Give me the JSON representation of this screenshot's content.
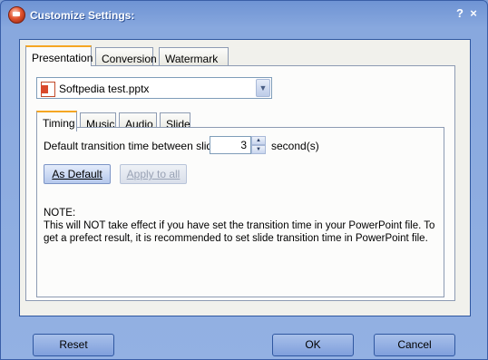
{
  "window": {
    "title": "Customize Settings:",
    "help_glyph": "?",
    "close_glyph": "×"
  },
  "outer_tabs": [
    "Presentation",
    "Conversion",
    "Watermark"
  ],
  "file_select": {
    "value": "Softpedia test.pptx",
    "arrow": "▼"
  },
  "inner_tabs": [
    "Timing",
    "Music",
    "Audio",
    "Slide"
  ],
  "timing": {
    "label": "Default transition time between slides:",
    "value": "3",
    "unit": "second(s)",
    "up": "▲",
    "down": "▼"
  },
  "buttons": {
    "as_default": "As Default",
    "apply_all": "Apply to all"
  },
  "note": {
    "title": "NOTE:",
    "body": "This will NOT take effect if you have set the transition time in your PowerPoint file. To get a prefect result, it is recommended to set slide transition time in PowerPoint file."
  },
  "footer": {
    "reset": "Reset",
    "ok": "OK",
    "cancel": "Cancel"
  }
}
